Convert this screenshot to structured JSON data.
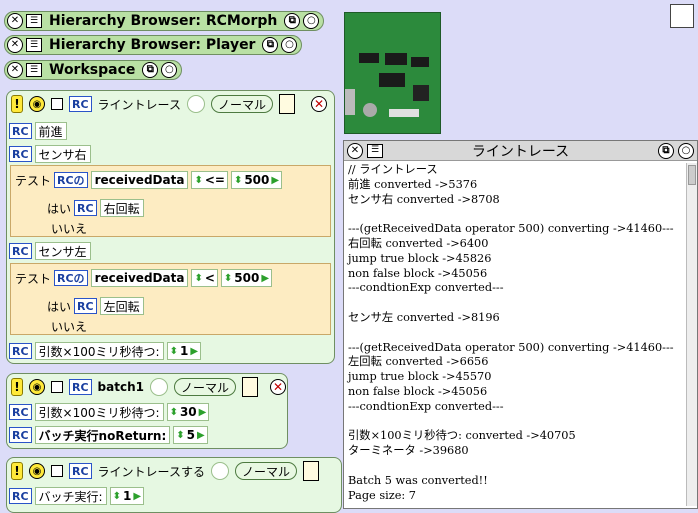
{
  "flaps": [
    {
      "title": "Hierarchy Browser: RCMorph"
    },
    {
      "title": "Hierarchy Browser: Player"
    },
    {
      "title": "Workspace"
    }
  ],
  "script1": {
    "name": "ライントレース",
    "mode": "ノーマル",
    "rc": "RC",
    "lines": [
      {
        "label": "前進"
      },
      {
        "label": "センサ右"
      },
      {
        "label": "センサ左"
      }
    ],
    "test1": {
      "test": "テスト",
      "of": "RCの",
      "prop": "receivedData",
      "op": "<=",
      "value": "500",
      "yes": "はい",
      "yes_action": "右回転",
      "no": "いいえ"
    },
    "test2": {
      "test": "テスト",
      "of": "RCの",
      "prop": "receivedData",
      "op": "<",
      "value": "500",
      "yes": "はい",
      "yes_action": "左回転",
      "no": "いいえ"
    },
    "wait": {
      "label": "引数×100ミリ秒待つ:",
      "value": "1"
    }
  },
  "script2": {
    "name": "batch1",
    "mode": "ノーマル",
    "wait": {
      "label": "引数×100ミリ秒待つ:",
      "value": "30"
    },
    "batch": {
      "label": "バッチ実行noReturn:",
      "value": "5"
    }
  },
  "script3": {
    "name": "ライントレースする",
    "mode": "ノーマル",
    "batch": {
      "label": "バッチ実行:",
      "value": "1"
    }
  },
  "transcript": {
    "title": "ライントレース",
    "text": "// ライントレース\n前進 converted ->5376\nセンサ右 converted ->8708\n\n---(getReceivedData operator 500) converting ->41460---\n右回転 converted ->6400\njump true block ->45826\nnon false block ->45056\n---condtionExp converted---\n\nセンサ左 converted ->8196\n\n---(getReceivedData operator 500) converting ->41460---\n左回転 converted ->6656\njump true block ->45570\nnon false block ->45056\n---condtionExp converted---\n\n引数×100ミリ秒待つ: converted ->40705\nターミネータ ->39680\n\nBatch 5 was converted!!\nPage size: 7"
  },
  "icons": {
    "close": "close-icon",
    "menu": "menu-icon",
    "collapse": "collapse-icon",
    "expand": "expand-icon"
  }
}
